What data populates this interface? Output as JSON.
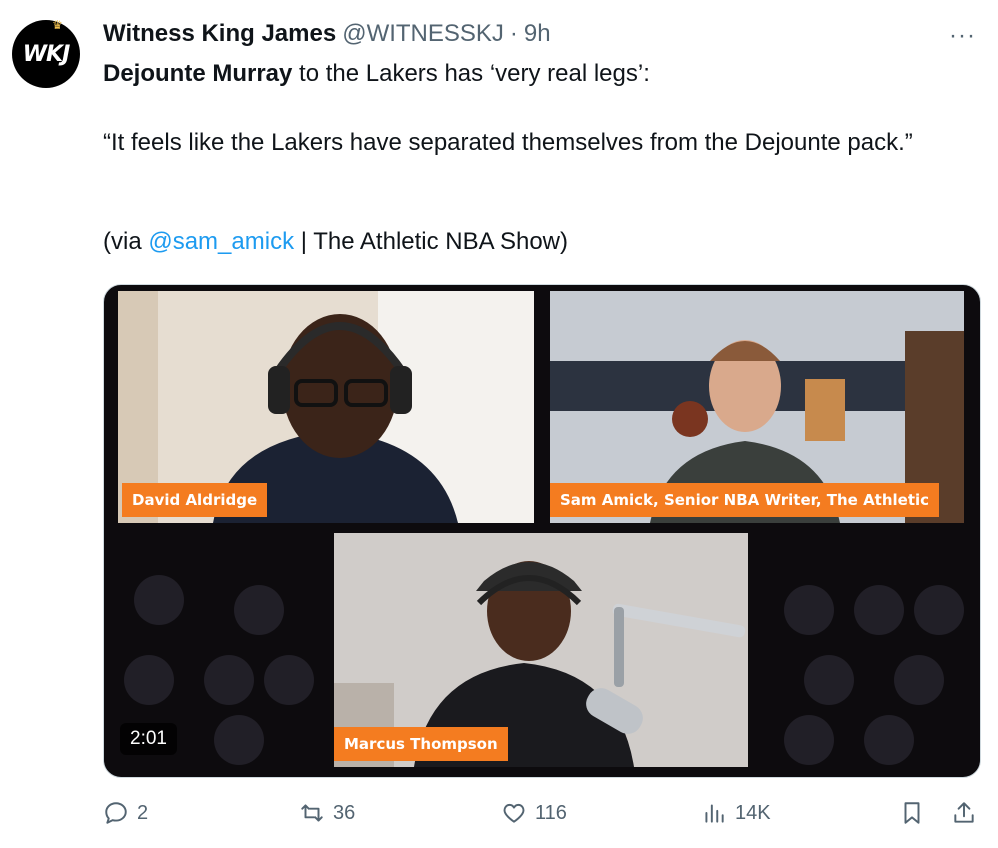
{
  "tweet": {
    "avatar_text": "WKJ",
    "display_name": "Witness King James",
    "handle": "@WITNESSKJ",
    "separator": "·",
    "time": "9h",
    "more": "···",
    "line1_bold": "Dejounte Murray",
    "line1_rest": " to the Lakers has ‘very real legs’:",
    "quote": "“It feels like the Lakers have separated themselves from the Dejounte pack.”",
    "via_prefix": "(via ",
    "via_mention": "@sam_amick",
    "via_suffix": " | The Athletic NBA Show)"
  },
  "video": {
    "labels": {
      "cam1": "David Aldridge",
      "cam2": "Sam Amick, Senior NBA Writer, The Athletic",
      "cam3": "Marcus Thompson"
    },
    "timestamp": "2:01",
    "accent_color": "#f47c20"
  },
  "actions": {
    "replies": "2",
    "retweets": "36",
    "likes": "116",
    "views": "14K"
  }
}
